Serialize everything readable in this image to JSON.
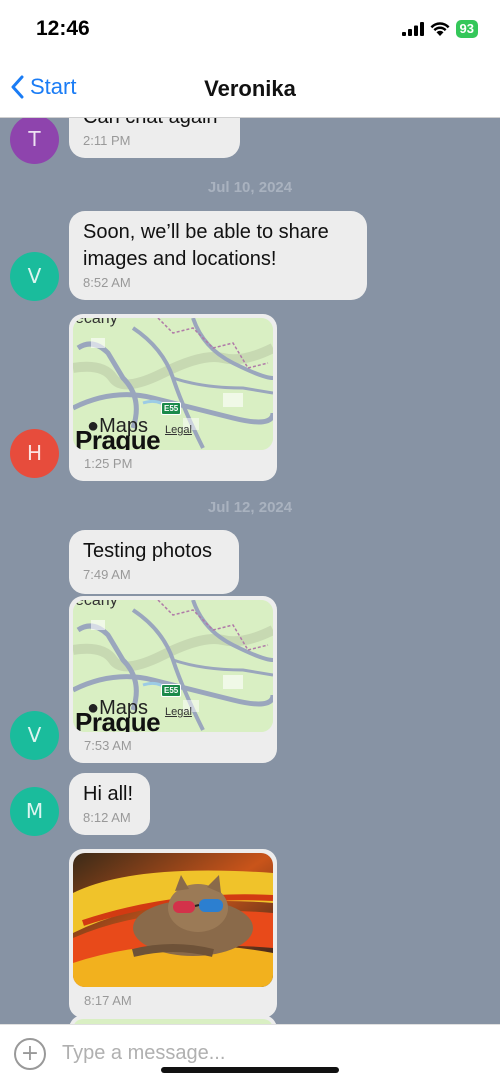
{
  "status": {
    "time": "12:46",
    "battery": "93"
  },
  "nav": {
    "back_label": "Start",
    "title": "Veronika"
  },
  "messages": [
    {
      "avatar": "T",
      "text": "Can chat again",
      "time": "2:11 PM",
      "color": "#8e44ad"
    },
    {
      "avatar": "V",
      "text": "Soon, we’ll be able to share images and locations!",
      "time": "8:52 AM",
      "color": "#1abc9c"
    },
    {
      "avatar": "H",
      "time": "1:25 PM",
      "color": "#e74c3c"
    },
    {
      "avatar": "V",
      "text": "Testing photos",
      "time": "7:49 AM",
      "color": "#1abc9c"
    },
    {
      "time": "7:53 AM"
    },
    {
      "avatar": "M",
      "text": "Hi all!",
      "time": "8:12 AM",
      "color": "#1abc9c"
    },
    {
      "time": "8:17 AM"
    }
  ],
  "dates": [
    "Jul 10, 2024",
    "Jul 12, 2024"
  ],
  "map": {
    "city": "Prague",
    "top_text": "ecany",
    "logo": "Maps",
    "legal": "Legal",
    "route": "E55"
  },
  "input": {
    "placeholder": "Type a message..."
  }
}
